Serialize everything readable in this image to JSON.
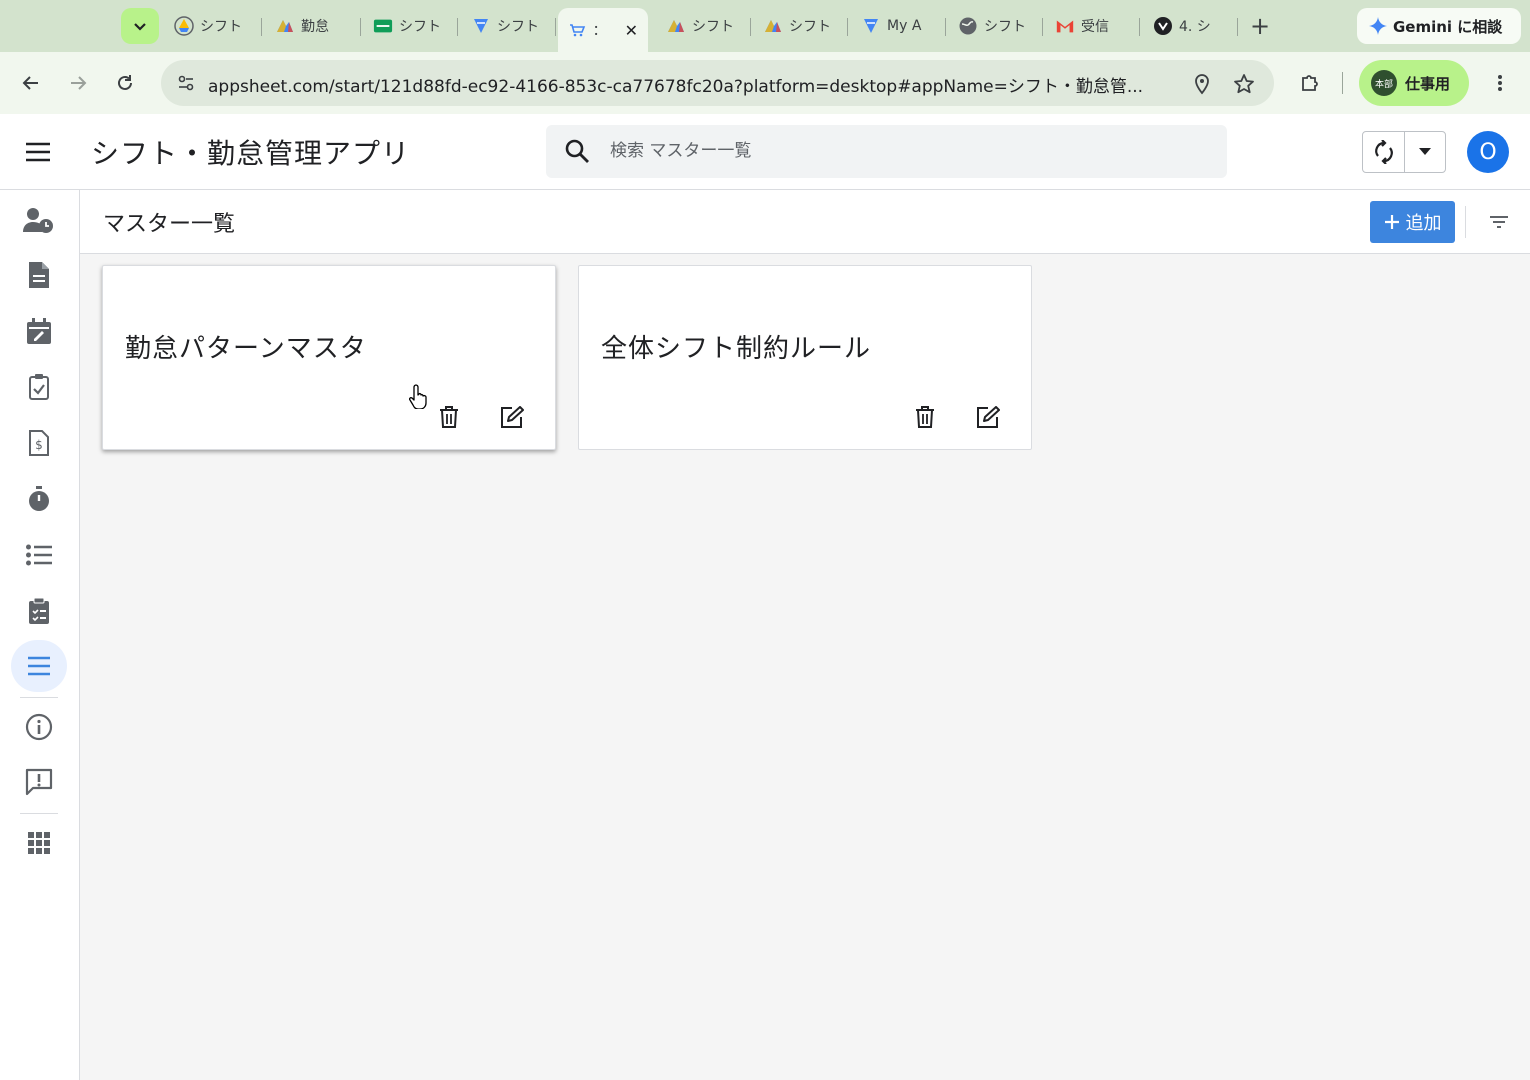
{
  "browser": {
    "tabs": [
      {
        "label": "シフト",
        "icon": "drive-icon",
        "color": "#fbbc04"
      },
      {
        "label": "勤怠",
        "icon": "appsheet-icon",
        "color": "#4285f4"
      },
      {
        "label": "シフト",
        "icon": "sheets-icon",
        "color": "#0f9d58"
      },
      {
        "label": "シフト",
        "icon": "form-icon",
        "color": "#4285f4"
      },
      {
        "label": "：",
        "icon": "cart-icon",
        "color": "#4285f4"
      },
      {
        "label": "シフト",
        "icon": "appsheet-icon",
        "color": "#4285f4"
      },
      {
        "label": "シフト",
        "icon": "appsheet-icon",
        "color": "#4285f4"
      },
      {
        "label": "My A",
        "icon": "form-icon",
        "color": "#4285f4"
      },
      {
        "label": "シフト",
        "icon": "globe-icon",
        "color": "#3c4043"
      },
      {
        "label": "受信",
        "icon": "gmail-icon",
        "color": "#ea4335"
      },
      {
        "label": "4. シ",
        "icon": "notion-icon",
        "color": "#202124"
      }
    ],
    "active_tab_index": 4,
    "new_tab_label": "+",
    "gemini_label": "Gemini に相談",
    "url": "appsheet.com/start/121d88fd-ec92-4166-853c-ca77678fc20a?platform=desktop#appName=シフト・勤怠管...",
    "profile_badge": "本部",
    "profile_label": "仕事用"
  },
  "app": {
    "title": "シフト・勤怠管理アプリ",
    "search_placeholder": "検索 マスター一覧",
    "user_initial": "O",
    "accent_color": "#3d85de"
  },
  "sidebar": {
    "items": [
      {
        "icon": "user-clock-icon"
      },
      {
        "icon": "document-icon"
      },
      {
        "icon": "calendar-edit-icon"
      },
      {
        "icon": "clipboard-check-icon"
      },
      {
        "icon": "invoice-icon"
      },
      {
        "icon": "stopwatch-icon"
      },
      {
        "icon": "list-icon"
      },
      {
        "icon": "clipboard-list-icon"
      },
      {
        "icon": "menu-lines-icon",
        "active": true
      },
      {
        "icon": "info-icon"
      },
      {
        "icon": "feedback-icon"
      },
      {
        "icon": "apps-grid-icon"
      }
    ]
  },
  "view": {
    "title": "マスター一覧",
    "add_label": "追加"
  },
  "cards": [
    {
      "title": "勤怠パターンマスタ"
    },
    {
      "title": "全体シフト制約ルール"
    }
  ]
}
